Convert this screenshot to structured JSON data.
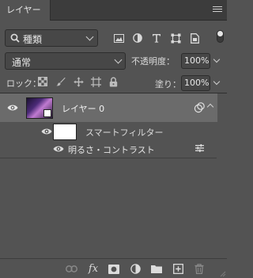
{
  "panel": {
    "tab_label": "レイヤー",
    "menu_icon": "hamburger-menu-icon"
  },
  "filter": {
    "kind_label": "種類",
    "icons": [
      "pixel-layer-filter-icon",
      "adjustment-layer-filter-icon",
      "type-layer-filter-icon",
      "shape-layer-filter-icon",
      "smart-object-filter-icon"
    ]
  },
  "blend": {
    "mode": "通常",
    "opacity_label": "不透明度：",
    "opacity_value": "100%"
  },
  "lock": {
    "label": "ロック：",
    "icons": [
      "lock-transparency-icon",
      "lock-image-icon",
      "lock-position-icon",
      "lock-artboard-icon",
      "lock-all-icon"
    ],
    "fill_label": "塗り：",
    "fill_value": "100%"
  },
  "layers": {
    "main_layer": {
      "name": "レイヤー 0",
      "visible": true
    },
    "smart_filters_label": "スマートフィルター",
    "filter_item": "明るさ・コントラスト"
  },
  "bottom_icons": [
    "link-layers-icon",
    "fx-icon",
    "layer-mask-icon",
    "adjustment-layer-icon",
    "group-folder-icon",
    "new-layer-icon",
    "trash-icon"
  ]
}
